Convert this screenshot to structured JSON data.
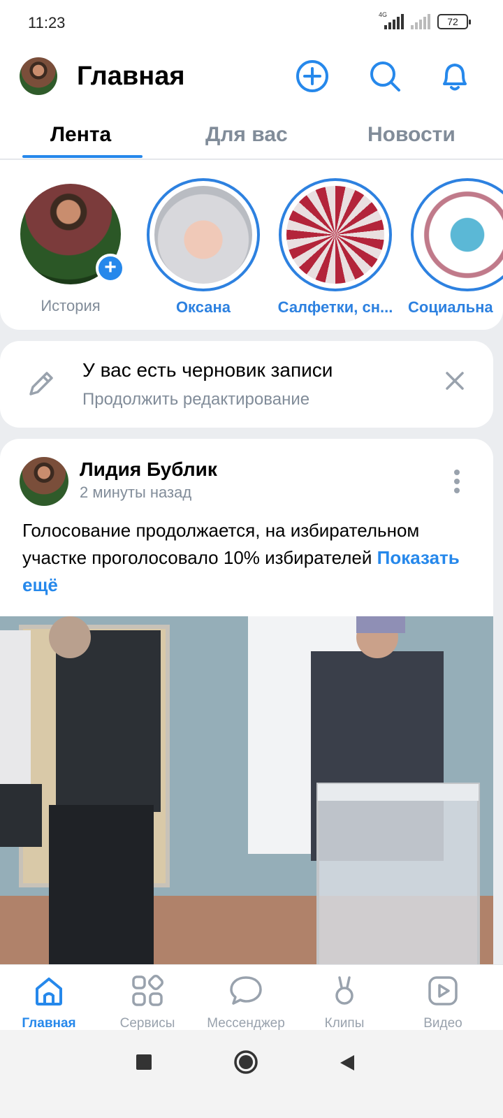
{
  "status_bar": {
    "time": "11:23",
    "network": "4G",
    "battery": "72"
  },
  "header": {
    "title": "Главная"
  },
  "tabs": [
    {
      "label": "Лента",
      "active": true
    },
    {
      "label": "Для вас",
      "active": false
    },
    {
      "label": "Новости",
      "active": false
    }
  ],
  "stories": [
    {
      "label": "История"
    },
    {
      "label": "Оксана"
    },
    {
      "label": "Салфетки, сн..."
    },
    {
      "label": "Социальна"
    }
  ],
  "draft": {
    "title": "У вас есть черновик записи",
    "subtitle": "Продолжить редактирование"
  },
  "post": {
    "author": "Лидия Бублик",
    "time": "2 минуты назад",
    "text": "Голосование продолжается, на избирательном участке проголосовало 10% избирателей",
    "show_more": "Показать ещё"
  },
  "bottom_nav": [
    {
      "label": "Главная",
      "icon": "home-icon",
      "active": true
    },
    {
      "label": "Сервисы",
      "icon": "services-icon",
      "active": false
    },
    {
      "label": "Мессенджер",
      "icon": "messenger-icon",
      "active": false
    },
    {
      "label": "Клипы",
      "icon": "clips-icon",
      "active": false
    },
    {
      "label": "Видео",
      "icon": "video-icon",
      "active": false
    }
  ],
  "colors": {
    "accent": "#2688eb",
    "secondary_text": "#818c99",
    "background": "#ebedf0"
  }
}
